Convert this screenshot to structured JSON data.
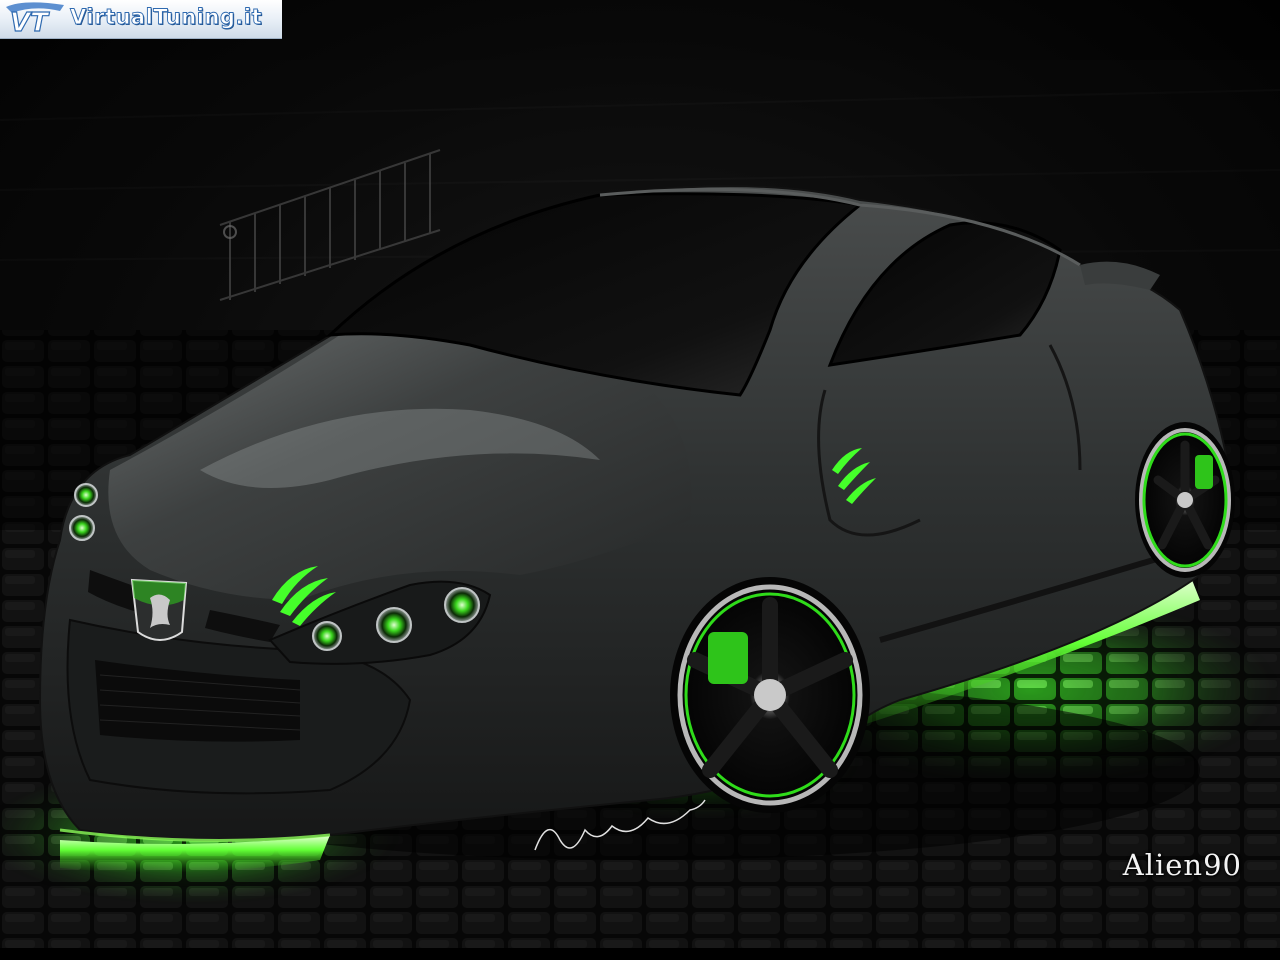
{
  "watermark": {
    "site_text": "VirtualTuning.it",
    "mark_text": "VT"
  },
  "artist_tag": "Alien90",
  "colors": {
    "glow": "#39ff2e",
    "body": "#2c2e2e",
    "background": "#050505",
    "logo_blue": "#2f6ab0"
  }
}
